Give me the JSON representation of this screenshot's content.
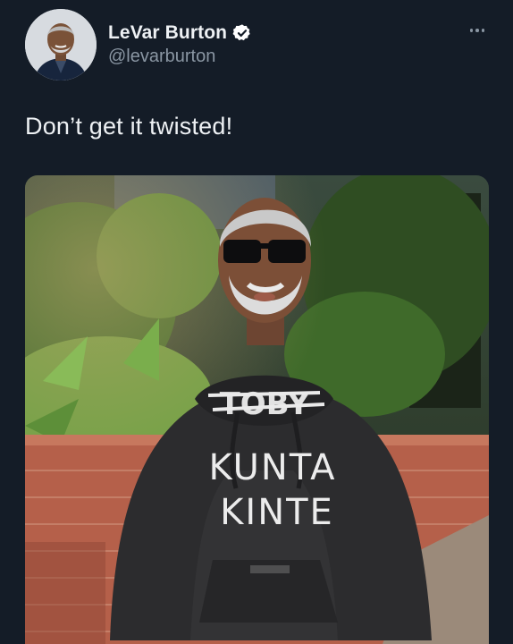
{
  "author": {
    "display_name": "LeVar Burton",
    "handle": "@levarburton",
    "verified": true,
    "avatar_icon": "profile-photo"
  },
  "tweet": {
    "text": "Don’t get it twisted!"
  },
  "menu": {
    "icon": "more-dots-icon"
  },
  "media": {
    "hoodie_text_crossed": "TOBY",
    "hoodie_text_line1": "KUNTA",
    "hoodie_text_line2": "KINTE"
  },
  "colors": {
    "background": "#141c27",
    "text_primary": "#eef1f4",
    "text_secondary": "#8a96a3",
    "verified_badge": "#ffffff"
  }
}
